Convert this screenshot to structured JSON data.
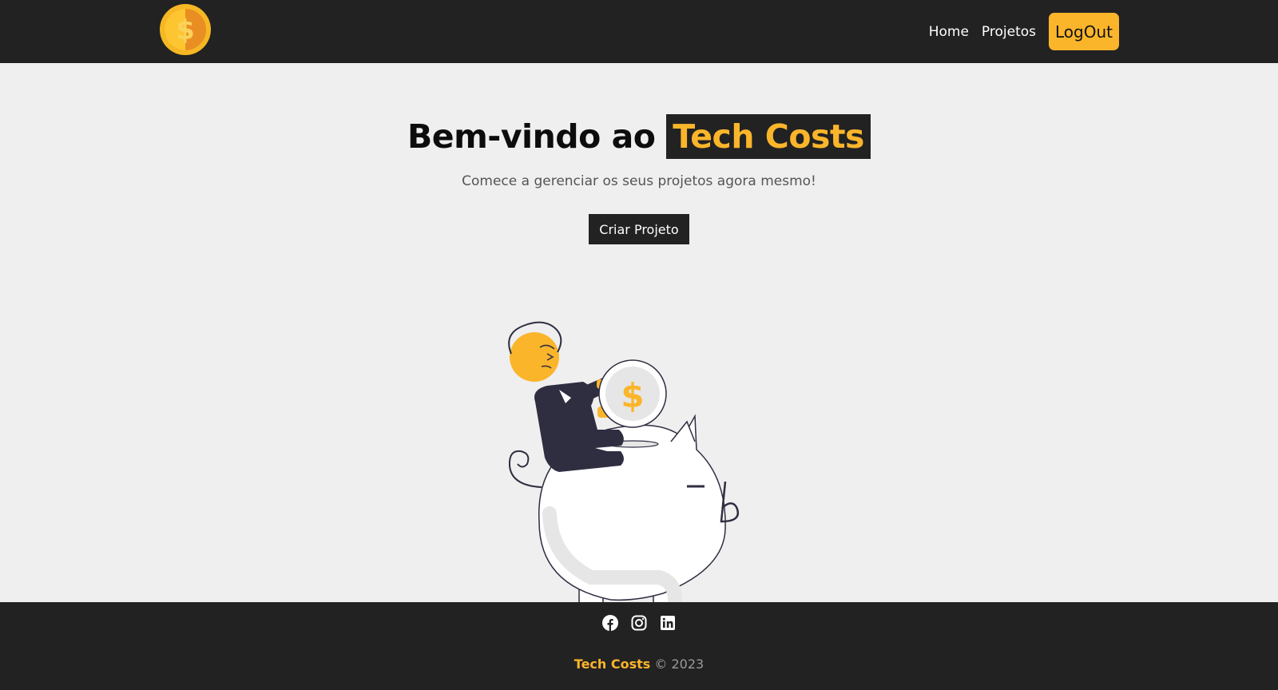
{
  "navbar": {
    "logo_icon": "dollar-coin-icon",
    "links": [
      {
        "label": "Home"
      },
      {
        "label": "Projetos"
      }
    ],
    "logout_label": "LogOut"
  },
  "hero": {
    "title_prefix": "Bem-vindo ao",
    "title_highlight": "Tech Costs",
    "subtitle": "Comece a gerenciar os seus projetos agora mesmo!",
    "cta_label": "Criar Projeto",
    "illustration": "piggy-bank-savings-illustration"
  },
  "footer": {
    "social_icons": [
      "facebook-icon",
      "instagram-icon",
      "linkedin-icon"
    ],
    "brand": "Tech Costs",
    "copyright": "© 2023"
  },
  "colors": {
    "dark": "#222222",
    "accent": "#fbb52b",
    "background": "#efefef"
  }
}
